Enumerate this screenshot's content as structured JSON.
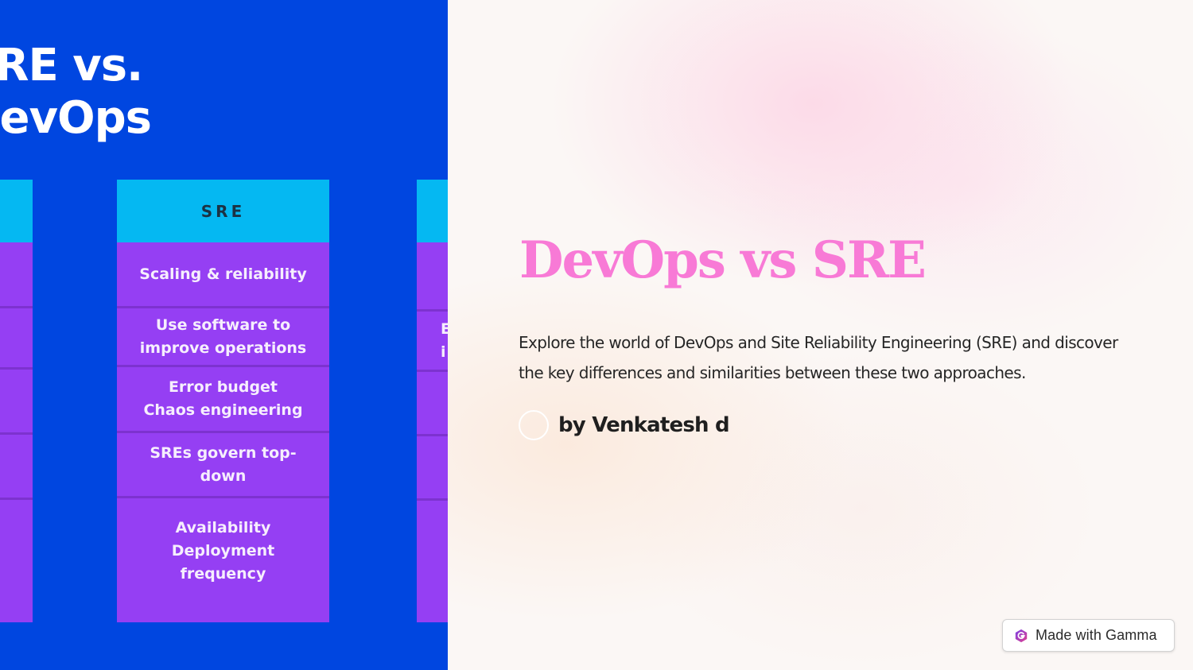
{
  "left_image": {
    "title_lines": [
      "SRE vs.",
      "DevOps"
    ],
    "columns": [
      {
        "header": "",
        "cells": [
          "",
          "",
          "",
          "",
          ""
        ]
      },
      {
        "header": "SRE",
        "cells": [
          "Scaling & reliability",
          "Use software to\nimprove operations",
          "Error budget\nChaos engineering",
          "SREs govern top-\ndown",
          "Availability\nDeployment\nfrequency"
        ]
      },
      {
        "header": "",
        "cells": [
          "",
          "E\ni",
          "",
          "",
          ""
        ]
      }
    ],
    "colors": {
      "background": "#0046e0",
      "header": "#05b8f2",
      "cell": "#953ff3"
    }
  },
  "card": {
    "title": "DevOps vs SRE",
    "description": "Explore the world of DevOps and Site Reliability Engineering (SRE) and discover the key differences and similarities between these two approaches.",
    "author": "by Venkatesh d",
    "title_color": "#f87ad6"
  },
  "badge": {
    "icon": "gamma-logo-icon",
    "label": "Made with Gamma"
  }
}
